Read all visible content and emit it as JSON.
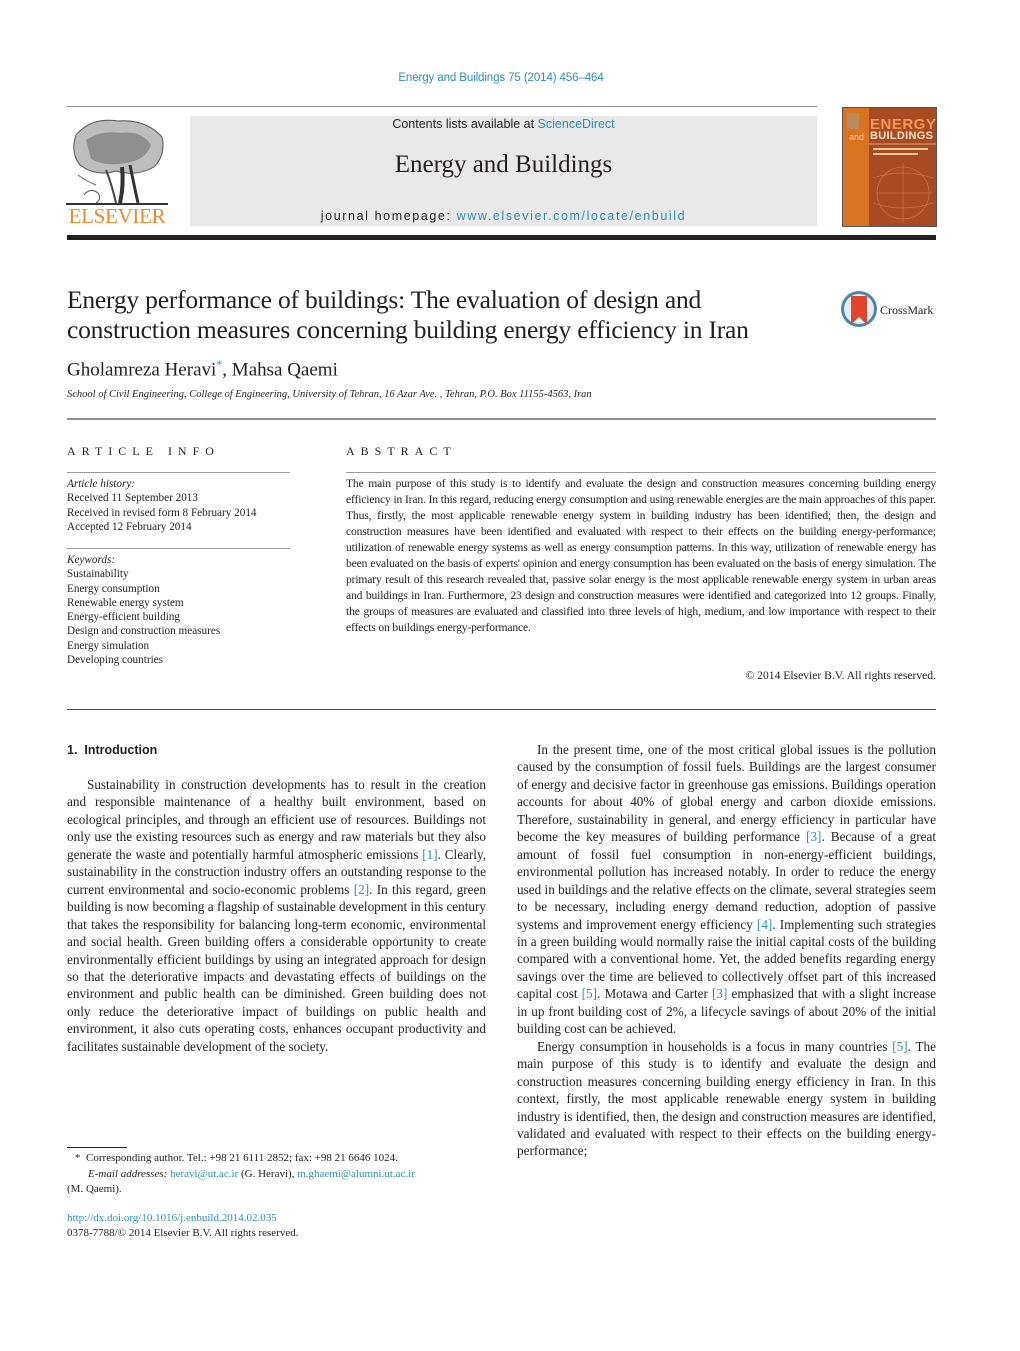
{
  "header": {
    "citation": "Energy and Buildings 75 (2014) 456–464",
    "contents_prefix": "Contents lists available at ",
    "contents_link": "ScienceDirect",
    "journal_name": "Energy and Buildings",
    "homepage_prefix": "journal homepage: ",
    "homepage_link": "www.elsevier.com/locate/enbuild",
    "publisher_logo_text": "ELSEVIER",
    "cover": {
      "title_line1": "ENERGY",
      "title_and": "and",
      "title_line2": "BUILDINGS",
      "colors": {
        "orange": "#d9731f",
        "brown": "#a84a22"
      }
    }
  },
  "article": {
    "title": "Energy performance of buildings: The evaluation of design and construction measures concerning building energy efficiency in Iran",
    "crossmark_label": "CrossMark",
    "authors": [
      {
        "name": "Gholamreza Heravi",
        "marker": "*"
      },
      {
        "name": "Mahsa Qaemi",
        "marker": ""
      }
    ],
    "author_separator": ", ",
    "affiliation": "School of Civil Engineering, College of Engineering, University of Tehran, 16 Azar Ave. , Tehran, P.O. Box 11155-4563, Iran"
  },
  "article_info": {
    "heading": "ARTICLE INFO",
    "history_label": "Article history:",
    "history": [
      "Received 11 September 2013",
      "Received in revised form 8 February 2014",
      "Accepted 12 February 2014"
    ],
    "keywords_label": "Keywords:",
    "keywords": [
      "Sustainability",
      "Energy consumption",
      "Renewable energy system",
      "Energy-efficient building",
      "Design and construction measures",
      "Energy simulation",
      "Developing countries"
    ]
  },
  "abstract": {
    "heading": "ABSTRACT",
    "text": "The main purpose of this study is to identify and evaluate the design and construction measures concerning building energy efficiency in Iran. In this regard, reducing energy consumption and using renewable energies are the main approaches of this paper. Thus, firstly, the most applicable renewable energy system in building industry has been identified; then, the design and construction measures have been identified and evaluated with respect to their effects on the building energy-performance; utilization of renewable energy systems as well as energy consumption patterns. In this way, utilization of renewable energy has been evaluated on the basis of experts' opinion and energy consumption has been evaluated on the basis of energy simulation. The primary result of this research revealed that, passive solar energy is the most applicable renewable energy system in urban areas and buildings in Iran. Furthermore, 23 design and construction measures were identified and categorized into 12 groups. Finally, the groups of measures are evaluated and classified into three levels of high, medium, and low importance with respect to their effects on buildings energy-performance.",
    "copyright": "© 2014 Elsevier B.V. All rights reserved."
  },
  "body": {
    "section_heading": "1.  Introduction",
    "left_paragraphs": [
      [
        {
          "t": "Sustainability in construction developments has to result in the creation and responsible maintenance of a healthy built environment, based on ecological principles, and through an efficient use of resources. Buildings not only use the existing resources such as energy and raw materials but they also generate the waste and potentially harmful atmospheric emissions "
        },
        {
          "ref": "[1]"
        },
        {
          "t": ". Clearly, sustainability in the construction industry offers an outstanding response to the current environmental and socio-economic problems "
        },
        {
          "ref": "[2]"
        },
        {
          "t": ". In this regard, green building is now becoming a flagship of sustainable development in this century that takes the responsibility for balancing long-term economic, environmental and social health. Green building offers a considerable opportunity to create environmentally efficient buildings by using an integrated approach for design so that the deteriorative impacts and devastating effects of buildings on the environment and public health can be diminished. Green building does not only reduce the deteriorative impact of buildings on public health and environment, it also cuts operating costs, enhances occupant productivity and facilitates sustainable development of the society."
        }
      ]
    ],
    "right_paragraphs": [
      [
        {
          "t": "In the present time, one of the most critical global issues is the pollution caused by the consumption of fossil fuels. Buildings are the largest consumer of energy and decisive factor in greenhouse gas emissions. Buildings operation accounts for about 40% of global energy and carbon dioxide emissions. Therefore, sustainability in general, and energy efficiency in particular have become the key measures of building performance "
        },
        {
          "ref": "[3]"
        },
        {
          "t": ". Because of a great amount of fossil fuel consumption in non-energy-efficient buildings, environmental pollution has increased notably. In order to reduce the energy used in buildings and the relative effects on the climate, several strategies seem to be necessary, including energy demand reduction, adoption of passive systems and improvement energy efficiency "
        },
        {
          "ref": "[4]"
        },
        {
          "t": ". Implementing such strategies in a green building would normally raise the initial capital costs of the building compared with a conventional home. Yet, the added benefits regarding energy savings over the time are believed to collectively offset part of this increased capital cost "
        },
        {
          "ref": "[5]"
        },
        {
          "t": ". Motawa and Carter "
        },
        {
          "ref": "[3]"
        },
        {
          "t": " emphasized that with a slight increase in up front building cost of 2%, a lifecycle savings of about 20% of the initial building cost can be achieved."
        }
      ],
      [
        {
          "t": "Energy consumption in households is a focus in many countries "
        },
        {
          "ref": "[5]"
        },
        {
          "t": ". The main purpose of this study is to identify and evaluate the design and construction measures concerning building energy efficiency in Iran. In this context, firstly, the most applicable renewable energy system in building industry is identified, then, the design and construction measures are identified, validated and evaluated with respect to their effects on the building energy-performance;"
        }
      ]
    ]
  },
  "footnote": {
    "marker": "*",
    "corresponding": "Corresponding author. Tel.: +98 21 6111 2852; fax: +98 21 6646 1024.",
    "email_label": "E-mail addresses:",
    "email1": "heravi@ut.ac.ir",
    "email1_owner": "(G. Heravi),",
    "email2": "m.ghaemi@alumni.ut.ac.ir",
    "email2_owner": "(M. Qaemi).",
    "doi": "http://dx.doi.org/10.1016/j.enbuild.2014.02.035",
    "issn_line": "0378-7788/© 2014 Elsevier B.V. All rights reserved."
  },
  "colors": {
    "link": "#2e8fb8",
    "elsevier_orange": "#f08a2c",
    "text": "#231f20",
    "banner_bg": "#e8e8e8"
  }
}
